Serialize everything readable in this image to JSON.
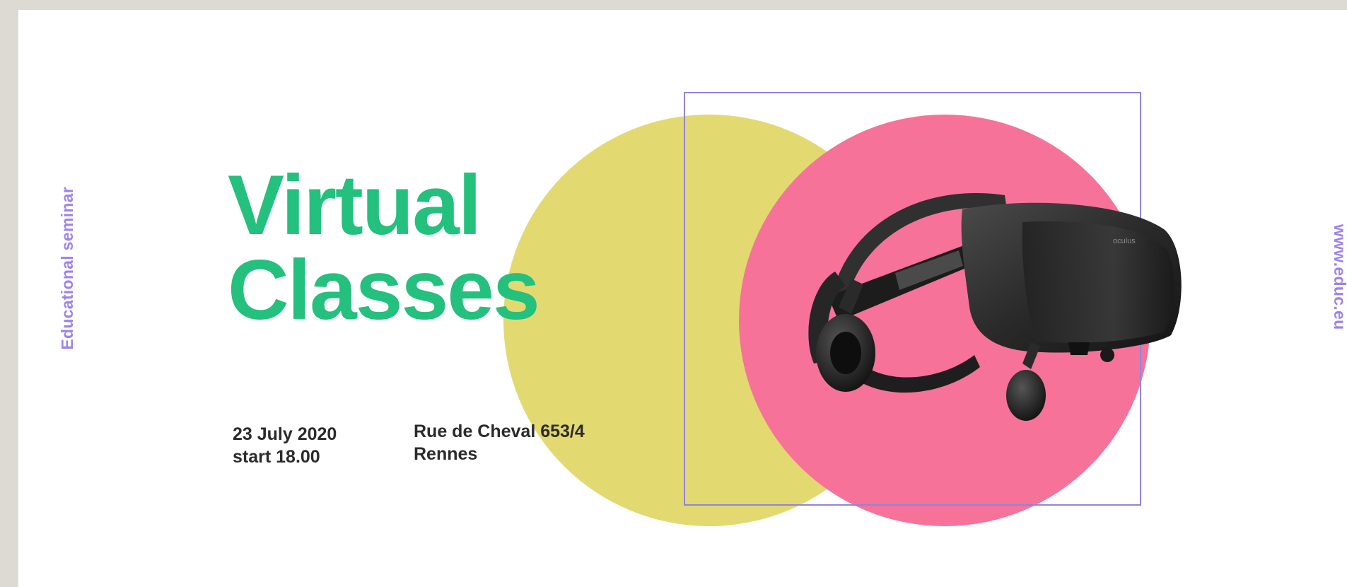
{
  "sidebar_left": {
    "label": "Educational seminar"
  },
  "sidebar_right": {
    "label": "www.educ.eu"
  },
  "headline": {
    "line1": "Virtual",
    "line2": "Classes"
  },
  "event": {
    "date": "23 July 2020",
    "start": "start 18.00",
    "street": "Rue de Cheval 653/4",
    "city": "Rennes"
  },
  "headset": {
    "brand": "oculus"
  },
  "colors": {
    "background": "#dcdad3",
    "card": "#ffffff",
    "accent_green": "#24c07e",
    "accent_purple": "#9d83ee",
    "yellow_circle": "#e3d971",
    "pink_circle": "#f77299",
    "frame_line": "#8f85d8"
  }
}
